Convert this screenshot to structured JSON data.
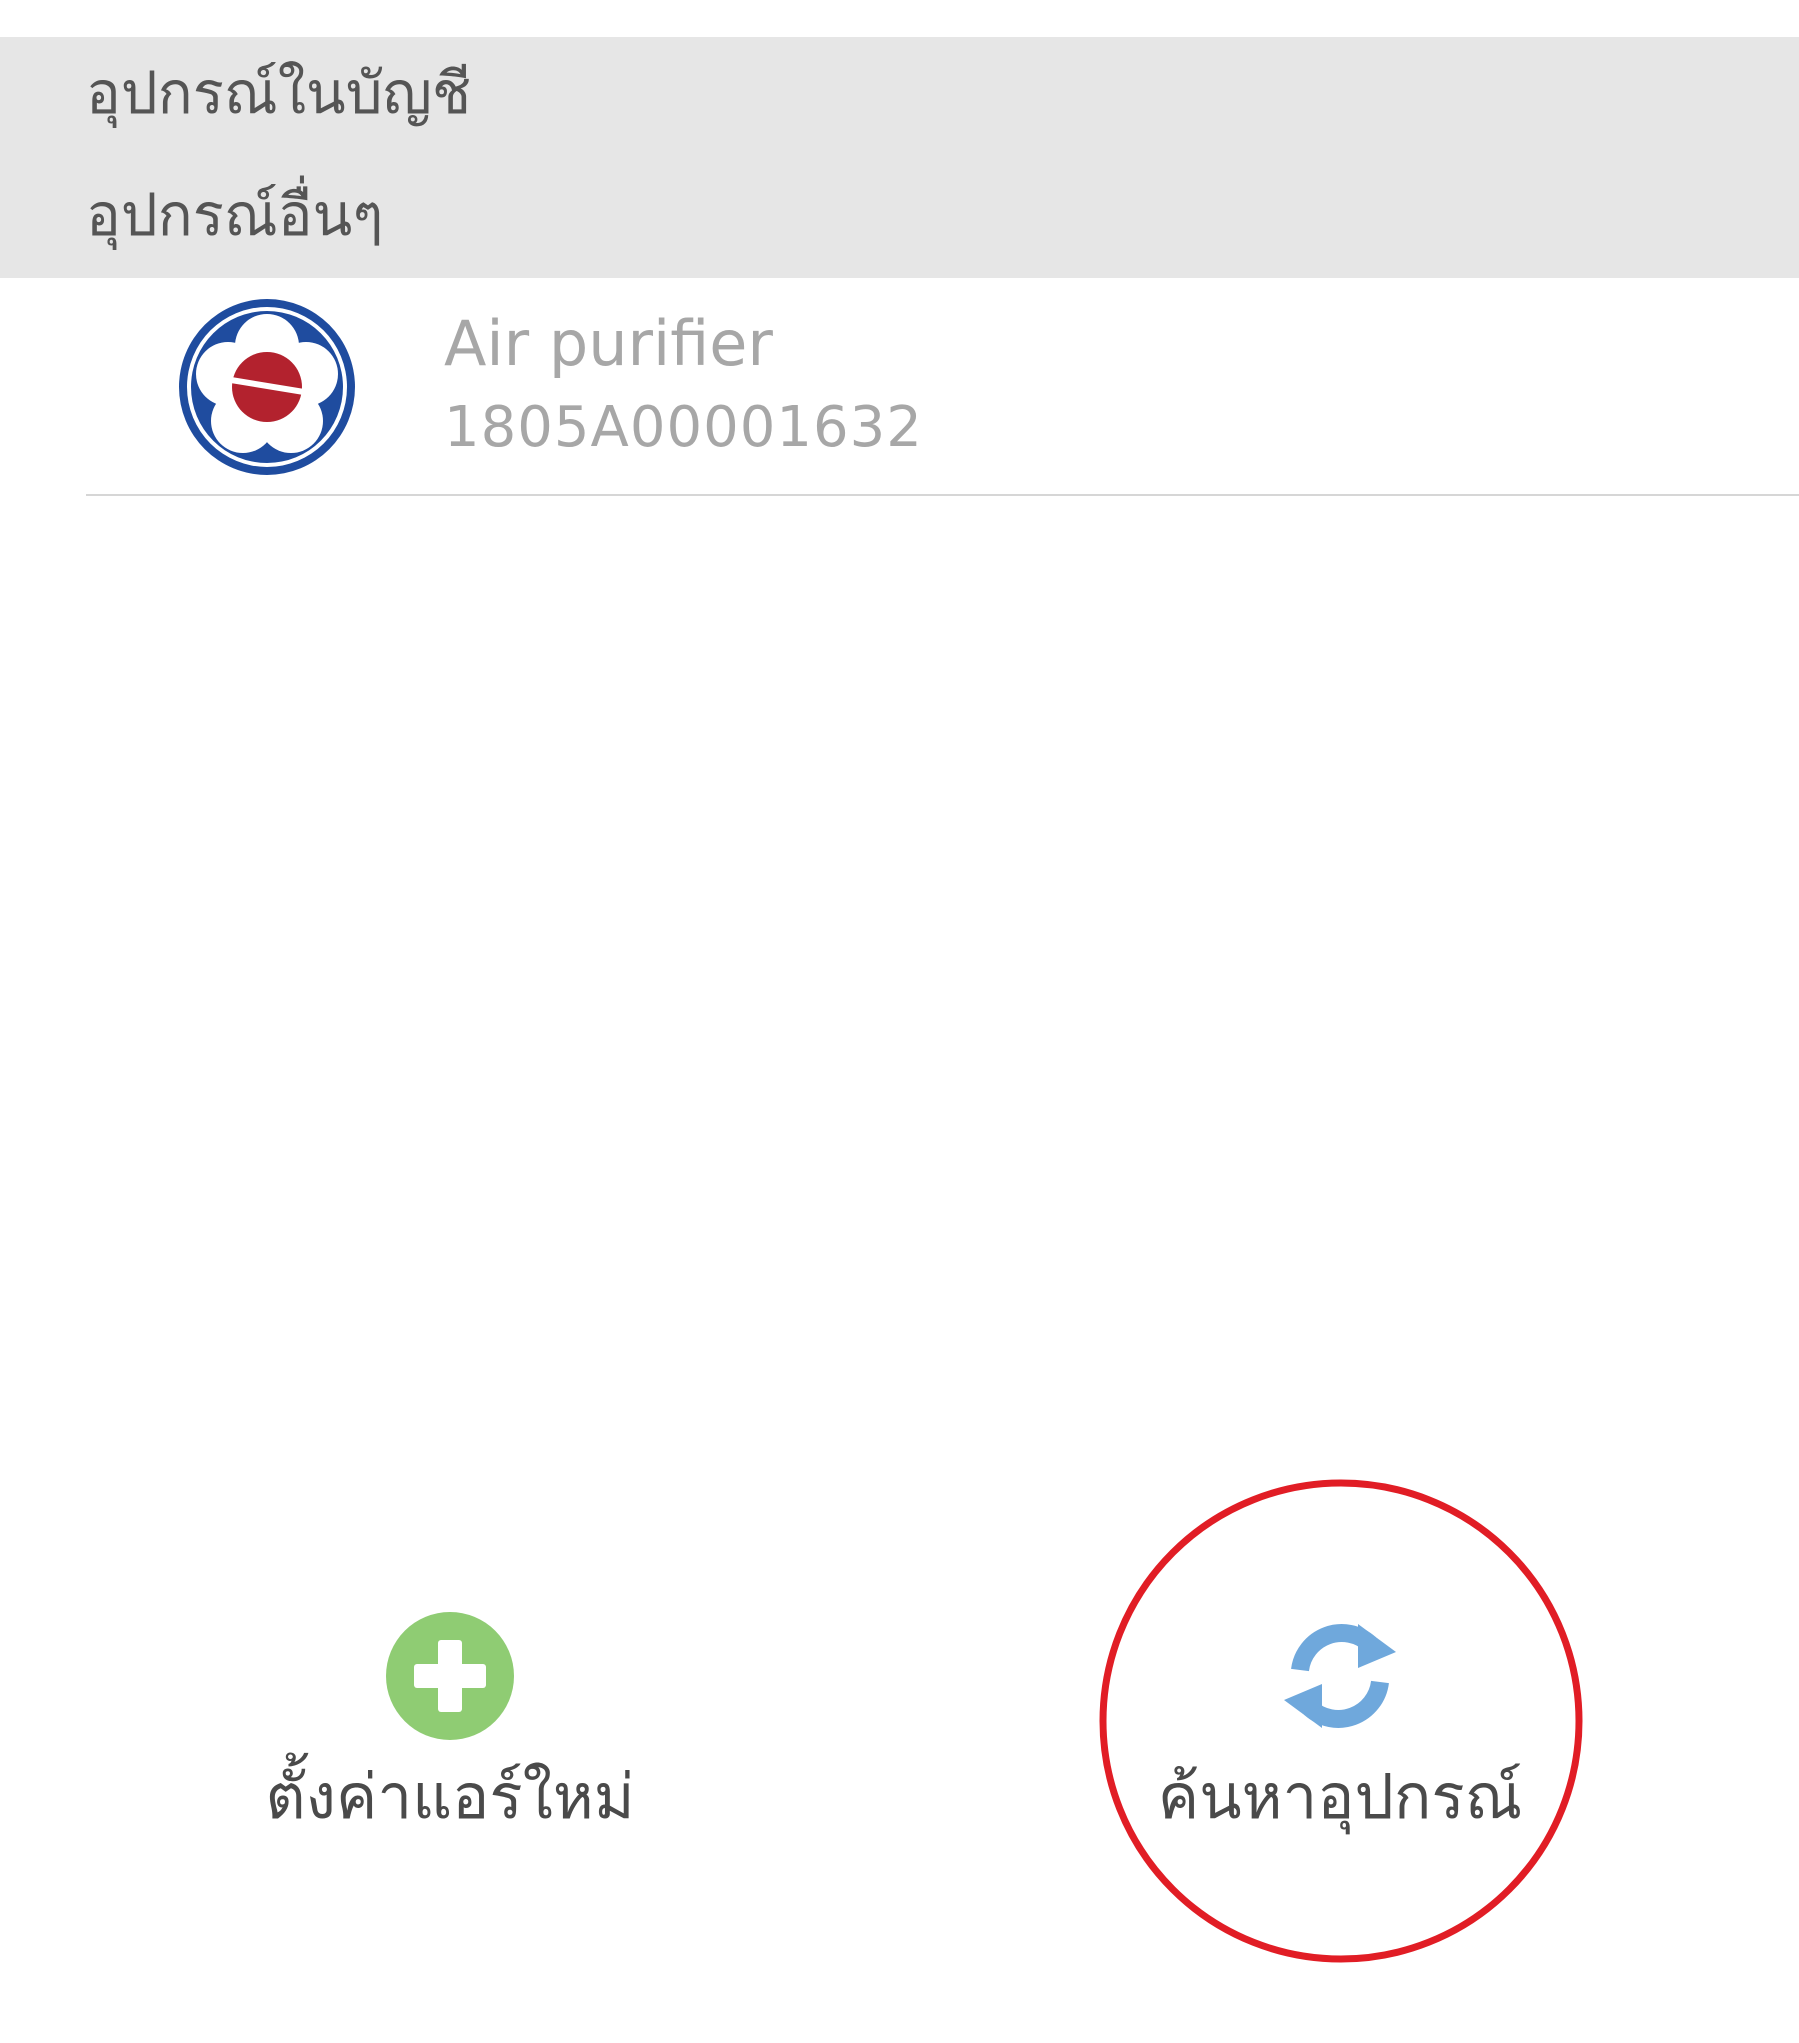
{
  "sections": {
    "account_devices": "อุปกรณ์ในบัญชี",
    "other_devices": "อุปกรณ์อื่นๆ"
  },
  "device": {
    "name": "Air purifier",
    "serial": "1805A00001632",
    "icon": "brand-logo-icon"
  },
  "actions": {
    "setup_label": "ตั้งค่าแอร์ใหม่",
    "setup_icon": "plus-circle-icon",
    "search_label": "ค้นหาอุปกรณ์",
    "search_icon": "refresh-icon"
  },
  "colors": {
    "header_band": "#e6e6e6",
    "plus_green": "#8fcc73",
    "refresh_blue": "#6fa8dc",
    "logo_blue": "#1f4c9f",
    "logo_red": "#b3222e",
    "highlight_red": "#e11d25"
  }
}
